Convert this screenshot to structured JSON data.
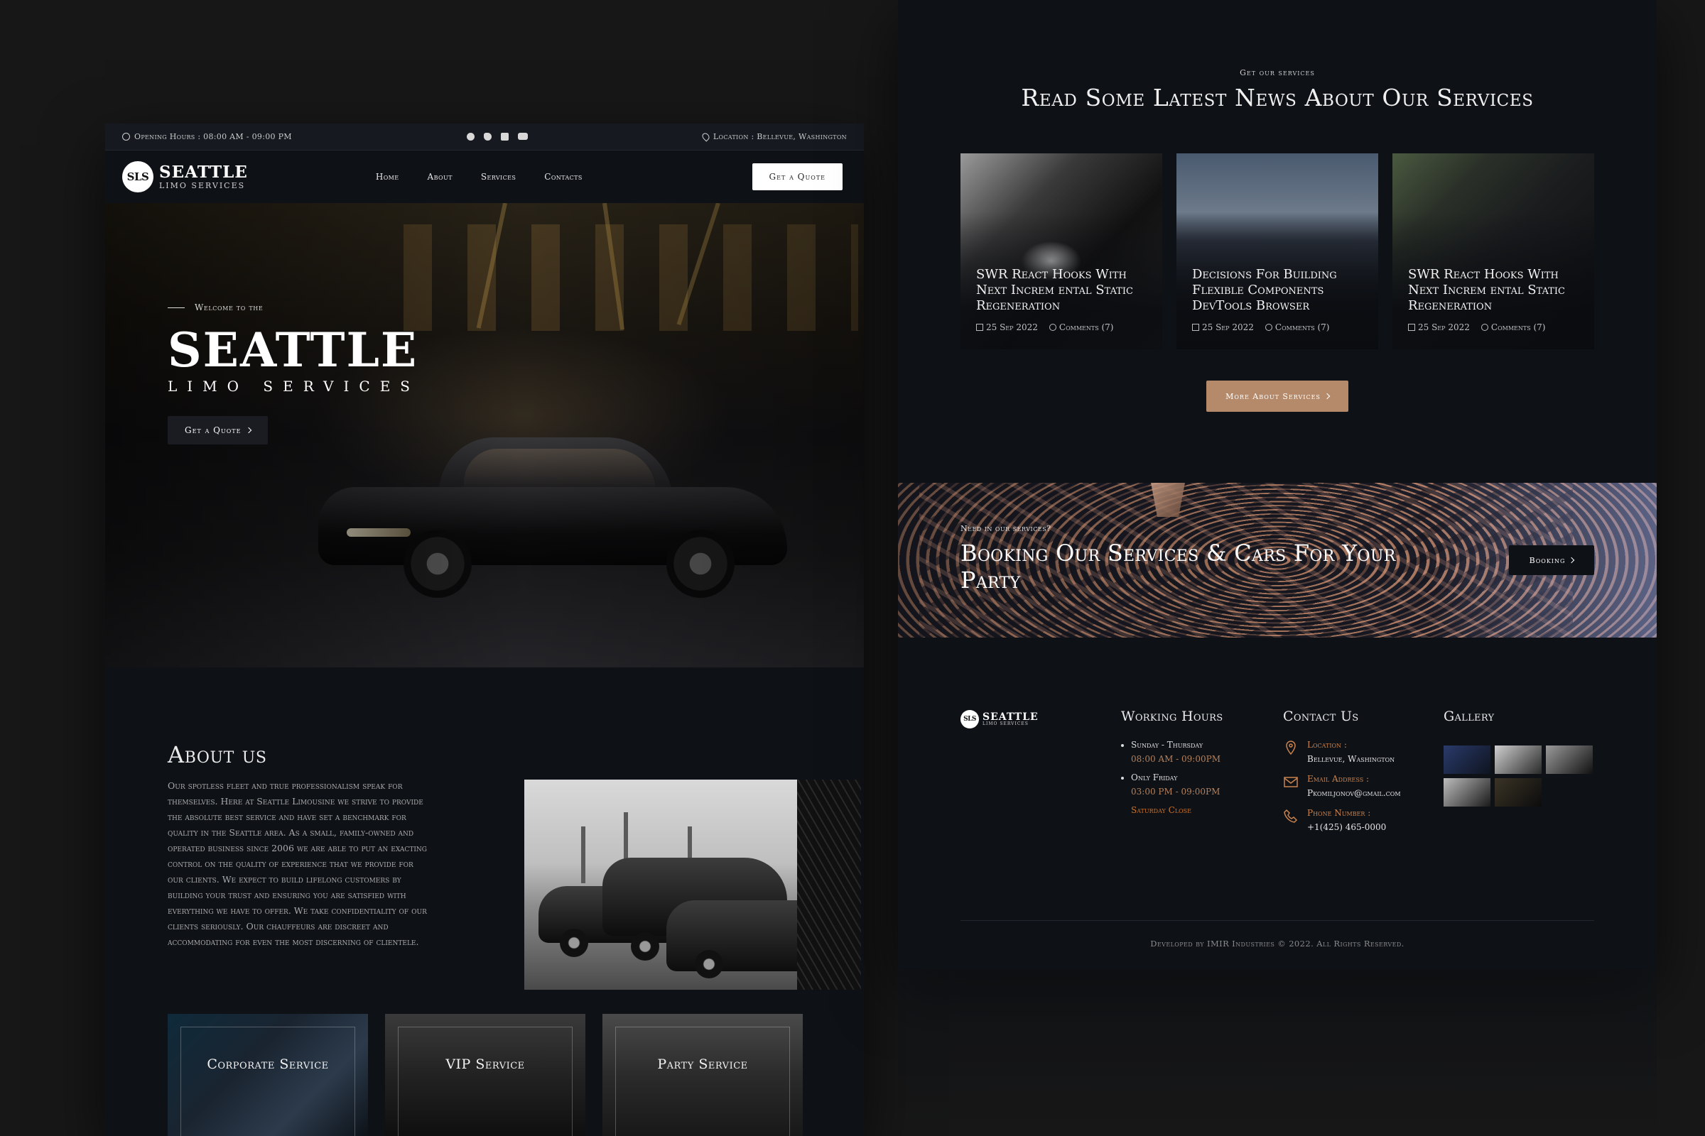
{
  "left": {
    "topbar": {
      "hours": "Opening Hours : 08:00 AM - 09:00 PM",
      "location": "Location : Bellevue, Washington",
      "socials": [
        "facebook-icon",
        "twitter-icon",
        "instagram-icon",
        "youtube-icon"
      ]
    },
    "brand": {
      "mark": "SLS",
      "name": "SEATTLE",
      "tagline": "LIMO SERVICES"
    },
    "nav": [
      "Home",
      "About",
      "Services",
      "Contacts"
    ],
    "quote_button": "Get a Quote",
    "hero": {
      "welcome": "Welcome to the",
      "title": "SEATTLE",
      "subtitle": "LIMO SERVICES",
      "cta": "Get a Quote"
    },
    "about": {
      "heading": "About us",
      "body": "Our spotless fleet and true professionalism speak for themselves. Here at Seattle Limousine we strive to provide the absolute best service and have set a benchmark for quality in the Seattle area. As a small, family-owned and operated business since 2006 we are able to put an exacting control on the quality of experience that we provide for our clients. We expect to build lifelong customers by building your trust and ensuring you are satisfied with everything we have to offer. We take confidentiality of our clients seriously. Our chauffeurs are discreet and accommodating for even the most discerning of clientele."
    },
    "services": [
      "Corporate Service",
      "VIP Service",
      "Party Service"
    ]
  },
  "right": {
    "news": {
      "kicker": "Get our services",
      "title": "Read Some Latest News About Our Services",
      "cards": [
        {
          "title": "SWR React Hooks With Next Increm ental Static Regeneration",
          "date": "25 Sep 2022",
          "comments": "Comments (7)"
        },
        {
          "title": "Decisions For Building Flexible Components DevTools Browser",
          "date": "25 Sep 2022",
          "comments": "Comments (7)"
        },
        {
          "title": "SWR React Hooks With Next Increm ental Static Regeneration",
          "date": "25 Sep 2022",
          "comments": "Comments (7)"
        }
      ],
      "more_button": "More About Services"
    },
    "booking": {
      "kicker": "Need in our services?",
      "title": "Booking Our Services & Cars For Your Party",
      "button": "Booking"
    },
    "footer": {
      "brand": {
        "mark": "SLS",
        "name": "SEATTLE",
        "tagline": "LIMO SERVICES"
      },
      "working_hours": {
        "heading": "Working Hours",
        "items": [
          {
            "day": "Sunday - Thursday",
            "time": "08:00 AM - 09:00PM"
          },
          {
            "day": "Only Friday",
            "time": "03:00 PM - 09:00PM"
          }
        ],
        "closed": "Saturday Close"
      },
      "contact": {
        "heading": "Contact Us",
        "items": [
          {
            "label": "Location :",
            "value": "Bellevue, Washington",
            "icon": "location-pin-icon"
          },
          {
            "label": "Email Address :",
            "value": "Pkomiljonov@gmail.com",
            "icon": "mail-icon"
          },
          {
            "label": "Phone Number :",
            "value": "+1(425) 465-0000",
            "icon": "phone-icon"
          }
        ]
      },
      "gallery": {
        "heading": "Gallery"
      },
      "copyright": "Developed by IMIR Industries © 2022. All Rights Reserved."
    }
  },
  "colors": {
    "background": "#171717",
    "page": "#0e1116",
    "accent_button": "#b58a6a",
    "accent_text": "#c8834f",
    "closed_text": "#d0742a"
  }
}
